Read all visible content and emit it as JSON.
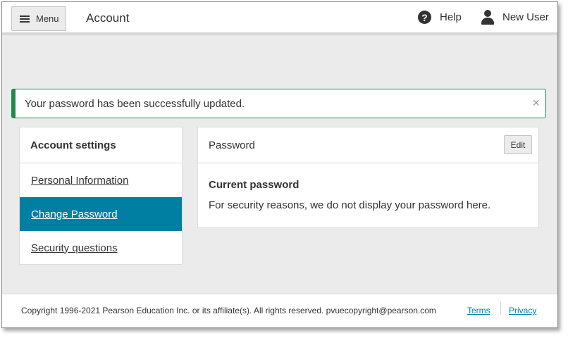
{
  "header": {
    "menu_label": "Menu",
    "title": "Account",
    "help_label": "Help",
    "user_label": "New User"
  },
  "alert": {
    "message": "Your password has been successfully updated.",
    "close_glyph": "×",
    "color": "#1f8a4c"
  },
  "sidebar": {
    "heading": "Account settings",
    "items": [
      {
        "label": "Personal Information",
        "active": false
      },
      {
        "label": "Change Password",
        "active": true
      },
      {
        "label": "Security questions",
        "active": false
      }
    ],
    "active_color": "#007fa3"
  },
  "panel": {
    "title": "Password",
    "edit_label": "Edit",
    "subtitle": "Current password",
    "text": "For security reasons, we do not display your password here."
  },
  "footer": {
    "copyright": "Copyright 1996-2021 Pearson Education Inc. or its affiliate(s). All rights reserved. pvuecopyright@pearson.com",
    "terms_label": "Terms",
    "privacy_label": "Privacy",
    "link_color": "#007fa3"
  },
  "icons": {
    "menu": "hamburger-icon",
    "help": "question-circle-icon",
    "user": "user-icon",
    "close": "close-icon"
  }
}
